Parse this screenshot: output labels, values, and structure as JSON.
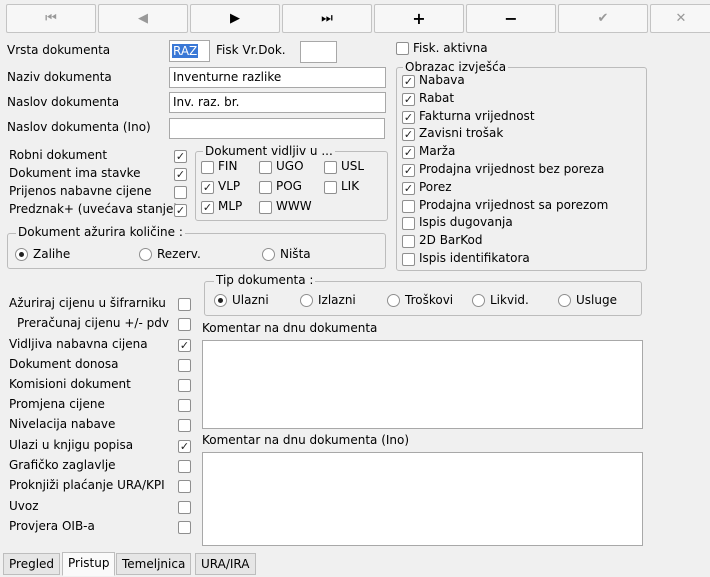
{
  "toolbar": {
    "first": "⏮",
    "prev": "◀",
    "next": "▶",
    "last": "⏭",
    "add": "+",
    "remove": "−",
    "confirm": "✔",
    "cancel": "✕"
  },
  "fields": {
    "vrsta_label": "Vrsta dokumenta",
    "vrsta_value": "RAZ",
    "fisk_vr_label": "Fisk Vr.Dok.",
    "fisk_vr_value": "",
    "fisk_aktivna_label": "Fisk. aktivna",
    "naziv_label": "Naziv dokumenta",
    "naziv_value": "Inventurne razlike",
    "naslov_label": "Naslov dokumenta",
    "naslov_value": "Inv. raz. br.",
    "naslov_ino_label": "Naslov dokumenta (Ino)",
    "naslov_ino_value": ""
  },
  "flags_top": [
    {
      "label": "Robni dokument",
      "checked": true
    },
    {
      "label": "Dokument ima stavke",
      "checked": true
    },
    {
      "label": "Prijenos nabavne cijene",
      "checked": false
    },
    {
      "label": "Predznak+ (uvećava stanje)",
      "checked": true
    }
  ],
  "vidljiv": {
    "title": "Dokument vidljiv u ...",
    "items": [
      {
        "label": "FIN",
        "checked": false
      },
      {
        "label": "UGO",
        "checked": false
      },
      {
        "label": "USL",
        "checked": false
      },
      {
        "label": "VLP",
        "checked": true
      },
      {
        "label": "POG",
        "checked": false
      },
      {
        "label": "LIK",
        "checked": false
      },
      {
        "label": "MLP",
        "checked": true
      },
      {
        "label": "WWW",
        "checked": false
      }
    ]
  },
  "obrazac": {
    "title": "Obrazac izvješća",
    "items": [
      {
        "label": "Nabava",
        "checked": true
      },
      {
        "label": "Rabat",
        "checked": true
      },
      {
        "label": "Fakturna vrijednost",
        "checked": true
      },
      {
        "label": "Zavisni trošak",
        "checked": true
      },
      {
        "label": "Marža",
        "checked": true
      },
      {
        "label": "Prodajna vrijednost bez poreza",
        "checked": true
      },
      {
        "label": "Porez",
        "checked": true
      },
      {
        "label": "Prodajna vrijednost sa porezom",
        "checked": false
      },
      {
        "label": "Ispis dugovanja",
        "checked": false
      },
      {
        "label": "2D BarKod",
        "checked": false
      },
      {
        "label": "Ispis identifikatora",
        "checked": false
      }
    ]
  },
  "azurira": {
    "title": "Dokument ažurira količine :",
    "options": [
      "Zalihe",
      "Rezerv.",
      "Ništa"
    ],
    "selected": "Zalihe"
  },
  "tip": {
    "title": "Tip dokumenta :",
    "options": [
      "Ulazni",
      "Izlazni",
      "Troškovi",
      "Likvid.",
      "Usluge"
    ],
    "selected": "Ulazni"
  },
  "flags_bottom": [
    {
      "label": "Ažuriraj cijenu u šifrarniku",
      "checked": false
    },
    {
      "label": "Preračunaj cijenu +/- pdv",
      "checked": false
    },
    {
      "label": "Vidljiva nabavna cijena",
      "checked": true
    },
    {
      "label": "Dokument donosa",
      "checked": false
    },
    {
      "label": "Komisioni dokument",
      "checked": false
    },
    {
      "label": "Promjena cijene",
      "checked": false
    },
    {
      "label": "Nivelacija nabave",
      "checked": false
    },
    {
      "label": "Ulazi u knjigu popisa",
      "checked": true
    },
    {
      "label": "Grafičko zaglavlje",
      "checked": false
    },
    {
      "label": "Proknjiži plaćanje URA/KPI",
      "checked": false
    },
    {
      "label": "Uvoz",
      "checked": false
    },
    {
      "label": "Provjera OIB-a",
      "checked": false
    }
  ],
  "komentar": {
    "label": "Komentar na dnu dokumenta",
    "value": "",
    "label_ino": "Komentar na dnu dokumenta (Ino)",
    "value_ino": ""
  },
  "tabs": [
    {
      "label": "Pregled",
      "active": false
    },
    {
      "label": "Pristup",
      "active": true
    },
    {
      "label": "Temeljnica",
      "active": false
    },
    {
      "label": "URA/IRA",
      "active": false
    }
  ]
}
